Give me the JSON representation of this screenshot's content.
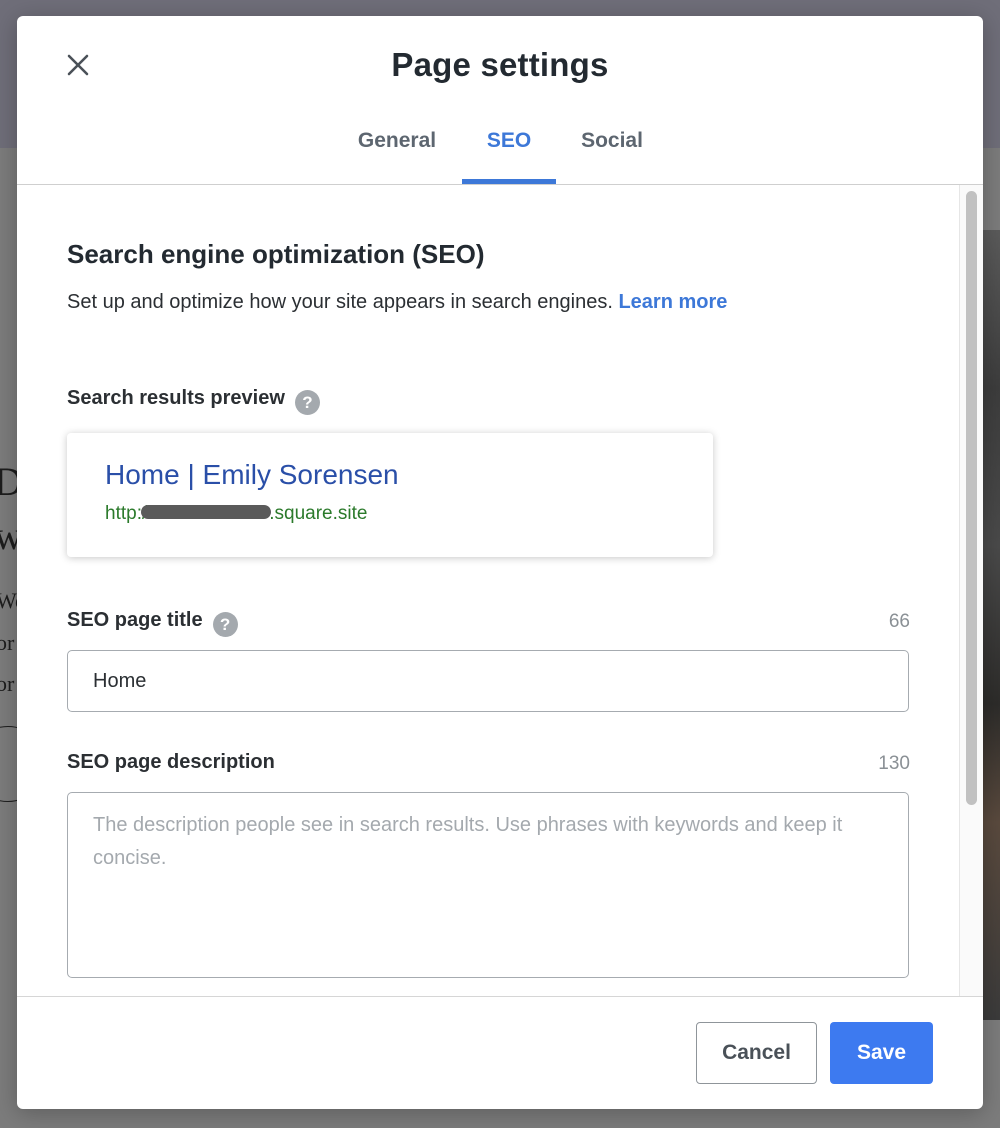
{
  "background": {
    "text_fragments": [
      "Di",
      "wi",
      "We",
      "or",
      "or"
    ]
  },
  "modal": {
    "title": "Page settings",
    "close_icon": "close-icon",
    "tabs": [
      {
        "label": "General",
        "active": false
      },
      {
        "label": "SEO",
        "active": true
      },
      {
        "label": "Social",
        "active": false
      }
    ]
  },
  "seo": {
    "heading": "Search engine optimization (SEO)",
    "description": "Set up and optimize how your site appears in search engines.",
    "learn_more": "Learn more",
    "preview": {
      "label": "Search results preview",
      "title": "Home | Emily Sorensen",
      "url_prefix": "http:/",
      "url_suffix": ".square.site"
    },
    "page_title": {
      "label": "SEO page title",
      "count": "66",
      "value": "Home"
    },
    "page_description": {
      "label": "SEO page description",
      "count": "130",
      "value": "",
      "placeholder": "The description people see in search results. Use phrases with keywords and keep it concise."
    }
  },
  "footer": {
    "cancel_label": "Cancel",
    "save_label": "Save"
  },
  "colors": {
    "accent": "#3d78d8",
    "save_button": "#3d7af0",
    "preview_title": "#2a4fa8",
    "preview_url": "#2b7a2b"
  }
}
